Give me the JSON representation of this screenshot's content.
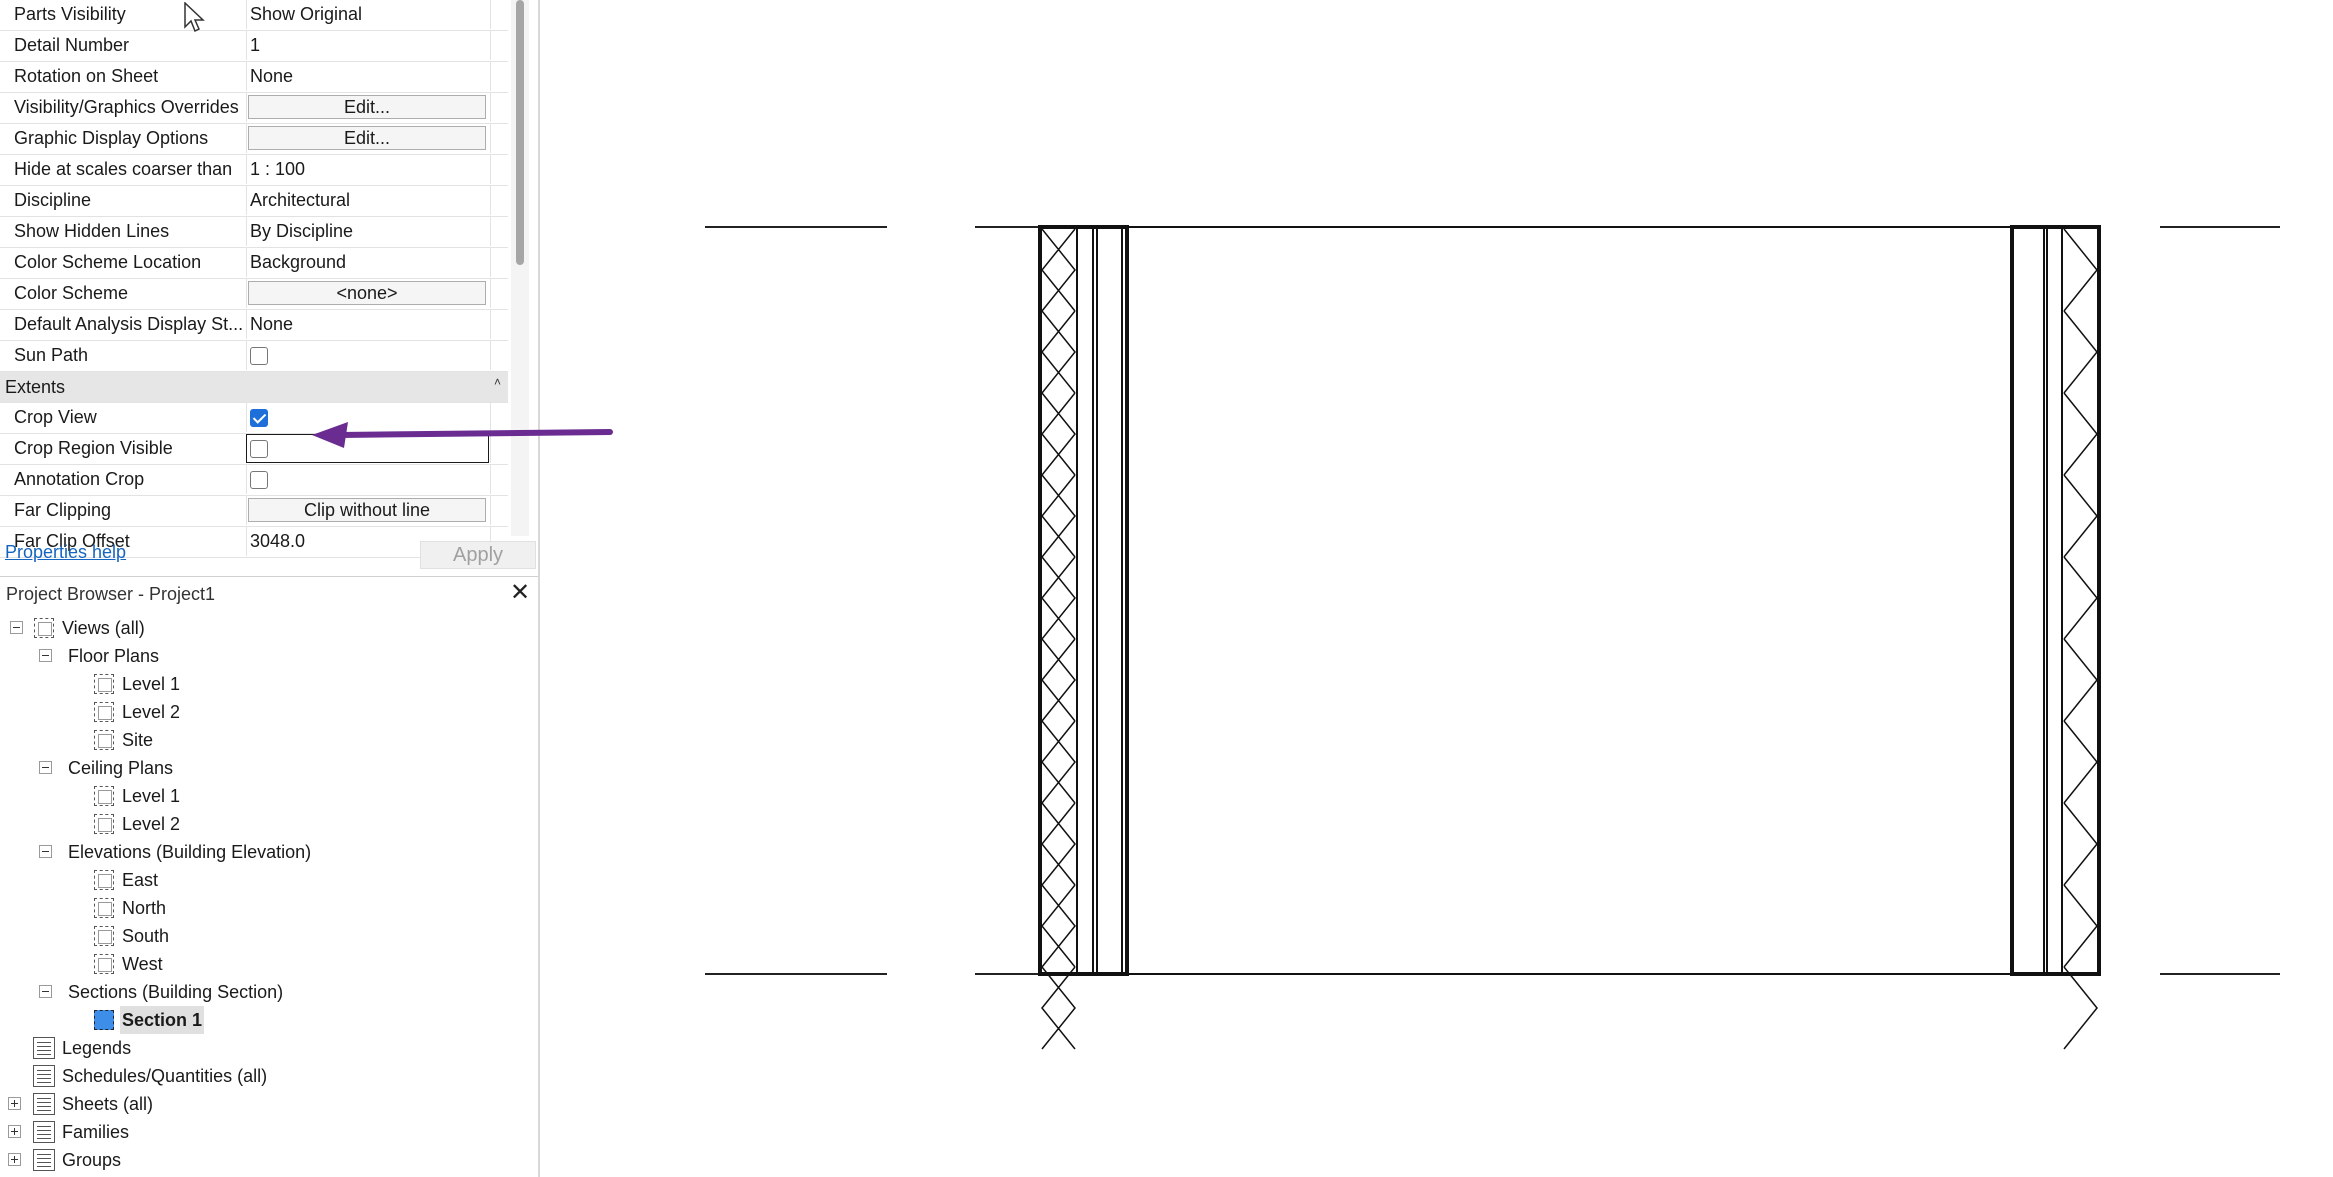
{
  "properties": {
    "rows": [
      {
        "name": "Parts Visibility",
        "value": "Show Original",
        "kind": "text"
      },
      {
        "name": "Detail Number",
        "value": "1",
        "kind": "text"
      },
      {
        "name": "Rotation on Sheet",
        "value": "None",
        "kind": "text"
      },
      {
        "name": "Visibility/Graphics Overrides",
        "value": "Edit...",
        "kind": "button"
      },
      {
        "name": "Graphic Display Options",
        "value": "Edit...",
        "kind": "button"
      },
      {
        "name": "Hide at scales coarser than",
        "value": "1 : 100",
        "kind": "text"
      },
      {
        "name": "Discipline",
        "value": "Architectural",
        "kind": "text"
      },
      {
        "name": "Show Hidden Lines",
        "value": "By Discipline",
        "kind": "text"
      },
      {
        "name": "Color Scheme Location",
        "value": "Background",
        "kind": "text"
      },
      {
        "name": "Color Scheme",
        "value": "<none>",
        "kind": "button"
      },
      {
        "name": "Default Analysis Display St...",
        "value": "None",
        "kind": "text"
      },
      {
        "name": "Sun Path",
        "checked": false,
        "kind": "checkbox"
      }
    ],
    "extents_header": "Extents",
    "extents_rows": [
      {
        "name": "Crop View",
        "checked": true,
        "kind": "checkbox"
      },
      {
        "name": "Crop Region Visible",
        "checked": false,
        "kind": "checkbox",
        "focused": true
      },
      {
        "name": "Annotation Crop",
        "checked": false,
        "kind": "checkbox"
      },
      {
        "name": "Far Clipping",
        "value": "Clip without line",
        "kind": "button"
      },
      {
        "name": "Far Clip Offset",
        "value": "3048.0",
        "kind": "text"
      }
    ],
    "help_link": "Properties help",
    "apply_label": "Apply"
  },
  "project_browser": {
    "title": "Project Browser - Project1",
    "close_glyph": "✕",
    "tree": {
      "views_all": "Views (all)",
      "floor_plans": "Floor Plans",
      "floor_level1": "Level 1",
      "floor_level2": "Level 2",
      "floor_site": "Site",
      "ceiling_plans": "Ceiling Plans",
      "ceiling_level1": "Level 1",
      "ceiling_level2": "Level 2",
      "elevations": "Elevations (Building Elevation)",
      "elev_east": "East",
      "elev_north": "North",
      "elev_south": "South",
      "elev_west": "West",
      "sections": "Sections (Building Section)",
      "section1": "Section 1",
      "legends": "Legends",
      "schedules": "Schedules/Quantities (all)",
      "sheets": "Sheets (all)",
      "families": "Families",
      "groups": "Groups"
    }
  },
  "colors": {
    "annotation_arrow": "#6a2c91",
    "selection_blue": "#3c8ee8",
    "link_blue": "#1565c0"
  }
}
